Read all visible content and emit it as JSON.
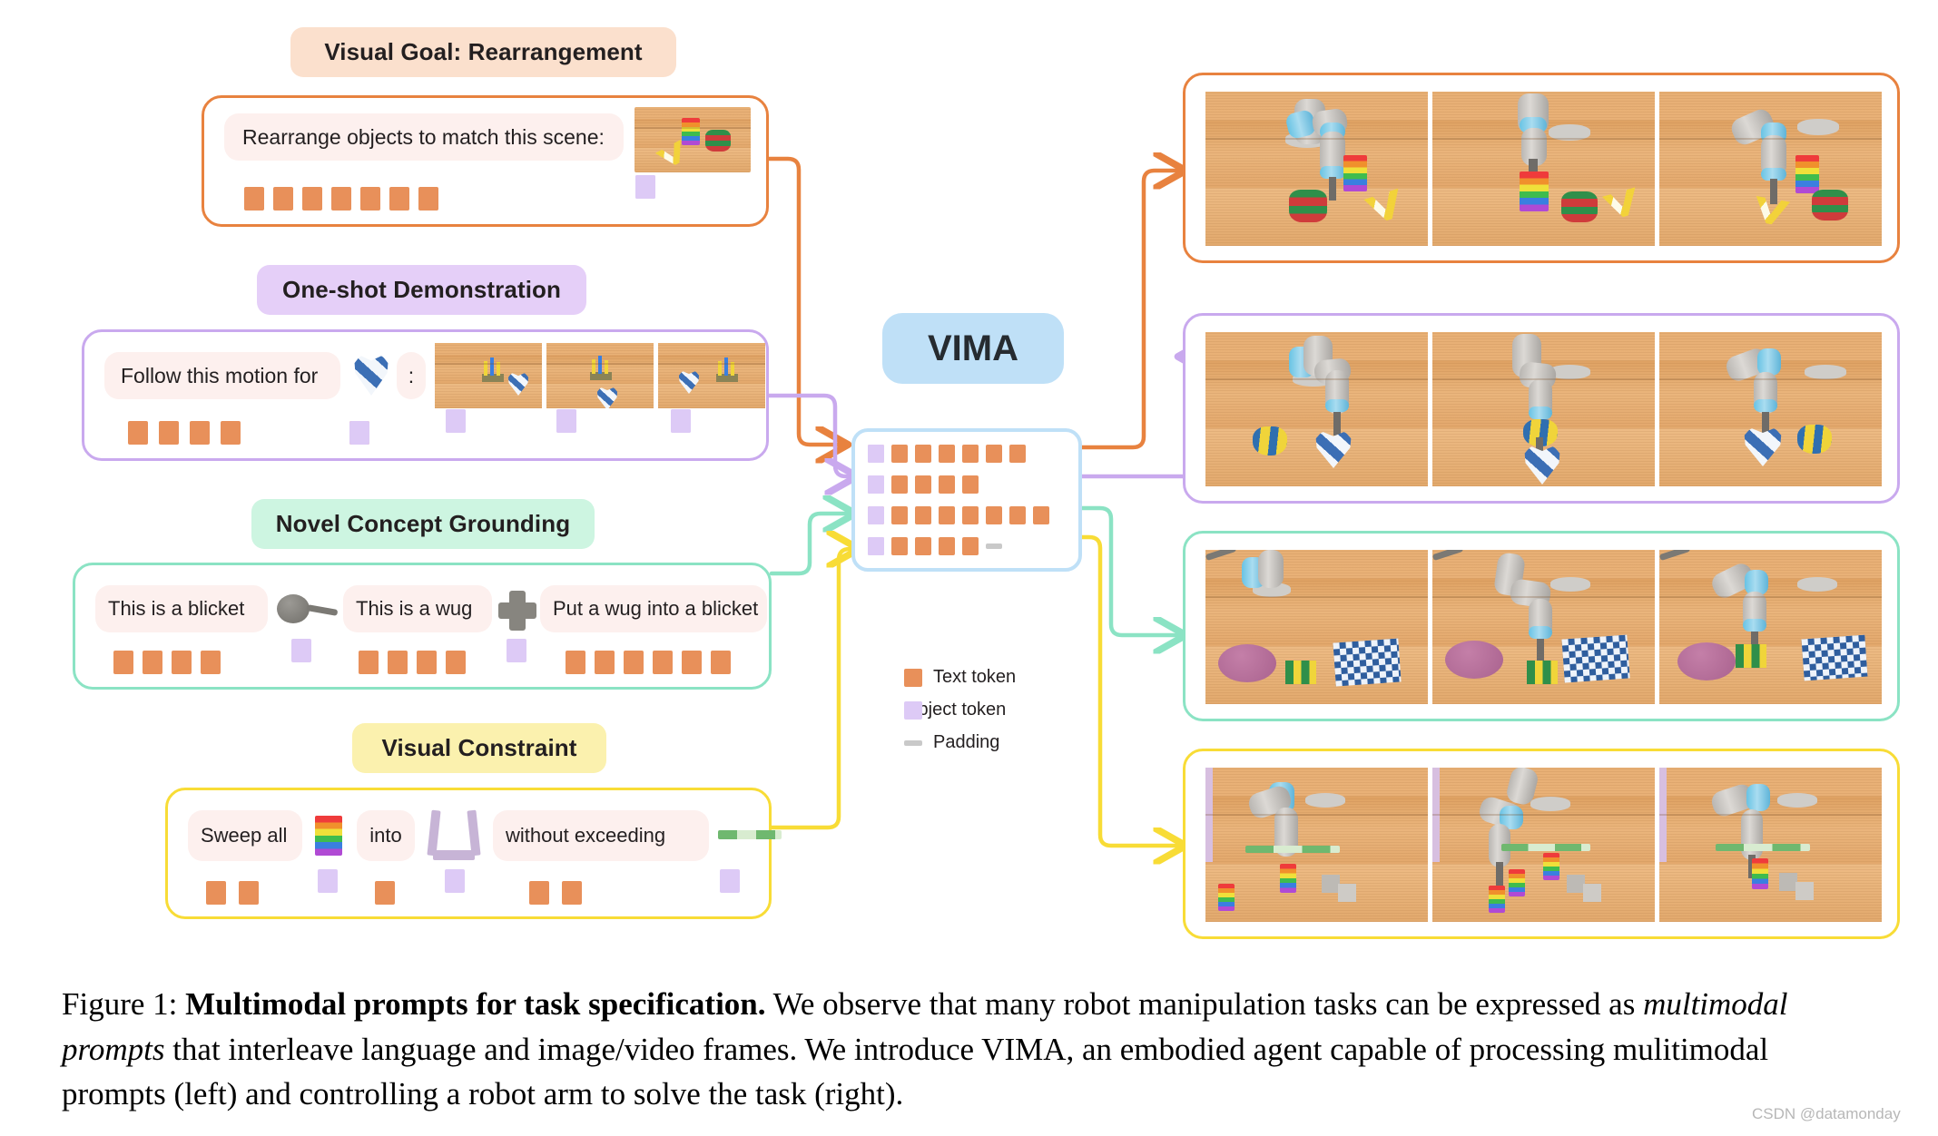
{
  "figure": {
    "caption_label": "Figure 1:",
    "caption_bold": "Multimodal prompts for task specification.",
    "caption_part1": " We observe that many robot manipulation tasks can be expressed as ",
    "caption_italic": "multimodal prompts",
    "caption_part2": " that interleave language and image/video frames. We introduce VIMA, an embodied agent capable of processing mulitimodal prompts (left) and controlling a robot arm to solve the task (right).",
    "watermark": "CSDN @datamonday"
  },
  "model": {
    "name": "VIMA",
    "grid": [
      [
        "text",
        "text",
        "text",
        "text",
        "text",
        "text",
        "text",
        "obj",
        "obj"
      ],
      [
        "text",
        "text",
        "text",
        "text",
        "obj",
        "text",
        "obj",
        "obj",
        "obj"
      ],
      [
        "text",
        "text",
        "text",
        "text",
        "obj",
        "text",
        "text",
        "text",
        "text"
      ],
      [
        "text",
        "text",
        "obj",
        "text",
        "obj",
        "text",
        "text",
        "obj",
        "pad"
      ]
    ]
  },
  "legend": {
    "items": [
      {
        "label": "Text token",
        "swatch": "text"
      },
      {
        "label": "Object token",
        "swatch": "obj"
      },
      {
        "label": "Padding",
        "swatch": "pad"
      }
    ]
  },
  "colors": {
    "text_token": "#e8905a",
    "object_token": "#ddcaf6",
    "padding_token": "#c9c9c9",
    "orange_accent": "#e8823f",
    "purple_accent": "#c9a9ee",
    "green_accent": "#8be3c4",
    "yellow_accent": "#f8dc36",
    "blue_accent": "#bfe0f7",
    "bubble_bg": "#fdf0ee"
  },
  "tasks": [
    {
      "id": "visual-goal",
      "title": "Visual Goal: Rearrangement",
      "pill_bg": "#fbe0cd",
      "accent": "#e8823f",
      "text": "Rearrange objects to match this scene:",
      "tokens": [
        {
          "type": "text",
          "count": 7
        },
        {
          "type": "obj",
          "count": 3
        }
      ]
    },
    {
      "id": "one-shot",
      "title": "One-shot Demonstration",
      "pill_bg": "#e5cff8",
      "accent": "#c9a9ee",
      "text": "Follow this motion for",
      "separator": ":",
      "tokens": [
        {
          "type": "text",
          "count": 4
        },
        {
          "type": "obj",
          "count": 1
        },
        {
          "type": "text",
          "count": 1
        },
        {
          "type": "obj",
          "count": 2
        },
        {
          "type": "obj",
          "count": 2
        },
        {
          "type": "obj",
          "count": 2
        }
      ]
    },
    {
      "id": "novel-concept",
      "title": "Novel Concept Grounding",
      "pill_bg": "#cdf5e1",
      "accent": "#8be3c4",
      "text_a": "This is a blicket",
      "text_b": "This is a wug",
      "text_c": "Put a wug into a blicket",
      "tokens": [
        {
          "type": "text",
          "count": 4
        },
        {
          "type": "obj",
          "count": 1
        },
        {
          "type": "text",
          "count": 4
        },
        {
          "type": "obj",
          "count": 1
        },
        {
          "type": "text",
          "count": 6
        }
      ]
    },
    {
      "id": "visual-constraint",
      "title": "Visual Constraint",
      "pill_bg": "#fbf1ae",
      "accent": "#f8dc36",
      "text_a": "Sweep all",
      "text_b": "into",
      "text_c": "without exceeding",
      "tokens": [
        {
          "type": "text",
          "count": 2
        },
        {
          "type": "obj",
          "count": 1
        },
        {
          "type": "text",
          "count": 1
        },
        {
          "type": "obj",
          "count": 1
        },
        {
          "type": "text",
          "count": 2
        },
        {
          "type": "obj",
          "count": 1
        }
      ]
    }
  ],
  "outputs": [
    {
      "id": "out-visual-goal",
      "accent": "#e8823f",
      "frames": 3
    },
    {
      "id": "out-one-shot",
      "accent": "#c9a9ee",
      "frames": 3
    },
    {
      "id": "out-novel-concept",
      "accent": "#8be3c4",
      "frames": 3
    },
    {
      "id": "out-visual-constraint",
      "accent": "#f8dc36",
      "frames": 3
    }
  ]
}
